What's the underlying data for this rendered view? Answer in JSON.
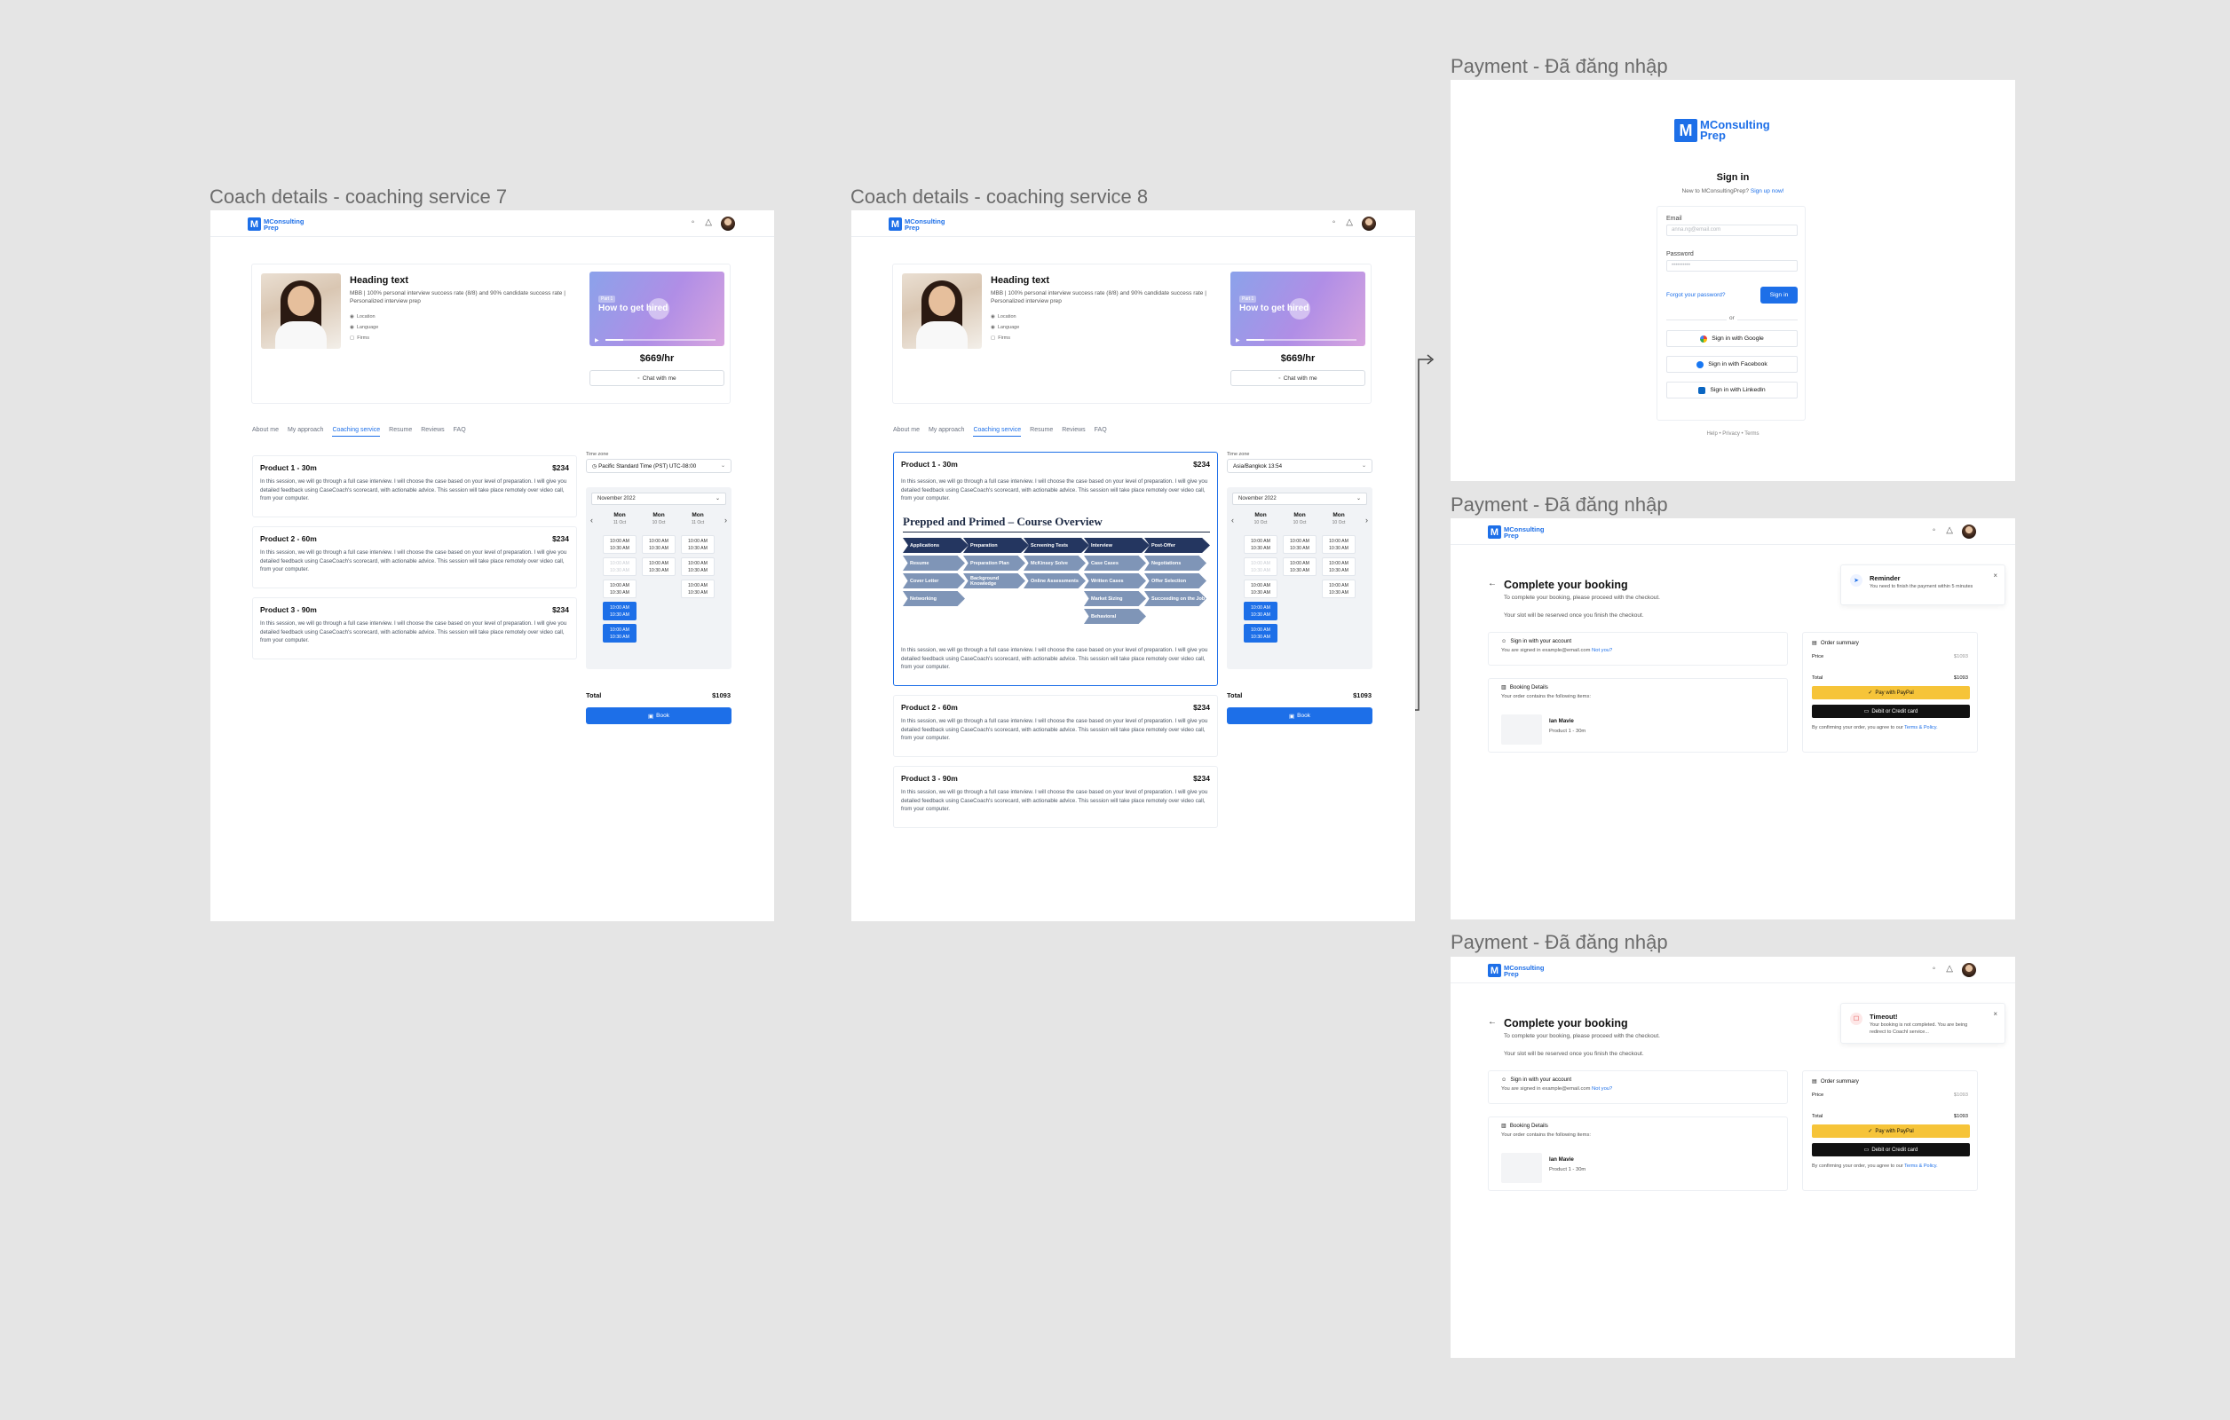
{
  "frames": {
    "coach7": {
      "label": "Coach details - coaching service 7"
    },
    "coach8": {
      "label": "Coach details - coaching service 8"
    },
    "pay1": {
      "label": "Payment - Đã đăng nhập"
    },
    "pay2": {
      "label": "Payment - Đã đăng nhập"
    },
    "pay3": {
      "label": "Payment - Đã đăng nhập"
    }
  },
  "brand": {
    "name": "MConsulting Prep",
    "logo_letter": "M",
    "accent": "#1d6fe8"
  },
  "header_icons": [
    "chat-icon",
    "bell-icon"
  ],
  "coach": {
    "heading": "Heading text",
    "description": "MBB | 100% personal interview success rate (8/8) and 90% candidate success rate | Personalized interview prep",
    "location": "Location",
    "language": "Language",
    "firms": "Firms",
    "video_tag": "Part 1",
    "video_title": "How to get hired",
    "price": "$669/hr",
    "chat_button": "Chat with me"
  },
  "tabs": [
    "About me",
    "My approach",
    "Coaching service",
    "Resume",
    "Reviews",
    "FAQ"
  ],
  "active_tab": "Coaching service",
  "products": [
    {
      "name": "Product 1 - 30m",
      "price": "$234",
      "description": "In this session, we will go through a full case interview. I will choose the case based on your level of preparation. I will give you detailed feedback using CaseCoach's scorecard, with actionable advice. This session will take place remotely over video call, from your computer."
    },
    {
      "name": "Product 2 - 60m",
      "price": "$234",
      "description": "In this session, we will go through a full case interview. I will choose the case based on your level of preparation. I will give you detailed feedback using CaseCoach's scorecard, with actionable advice. This session will take place remotely over video call, from your computer."
    },
    {
      "name": "Product 3 - 90m",
      "price": "$234",
      "description": "In this session, we will go through a full case interview. I will choose the case based on your level of preparation. I will give you detailed feedback using CaseCoach's scorecard, with actionable advice. This session will take place remotely over video call, from your computer."
    }
  ],
  "course_overview": {
    "title": "Prepped and Primed – Course Overview",
    "stages": [
      "Applications",
      "Preparation",
      "Screening Tests",
      "Interview",
      "Post-Offer"
    ],
    "items": [
      "Resume",
      "Preparation Plan",
      "McKinsey Solve",
      "Case Cases",
      "Negotiations",
      "Cover Letter",
      "Background Knowledge",
      "Online Assessments",
      "Written Cases",
      "Offer Selection",
      "Networking",
      "Market Sizing",
      "Succeeding on the Job",
      "Behavioral"
    ]
  },
  "booking_panel": {
    "timezone_label": "Time zone",
    "timezone_value_7": "Pacific Standard Time (PST) UTC-08:00",
    "timezone_value_8": "Asia/Bangkok 13:54",
    "month": "November 2022",
    "days_7": [
      {
        "name": "Mon",
        "date": "11 Oct"
      },
      {
        "name": "Mon",
        "date": "10 Oct"
      },
      {
        "name": "Mon",
        "date": "11 Oct"
      }
    ],
    "days_8": [
      {
        "name": "Mon",
        "date": "10 Oct"
      },
      {
        "name": "Mon",
        "date": "10 Oct"
      },
      {
        "name": "Mon",
        "date": "10 Oct"
      }
    ],
    "slot_line1": "10:00 AM",
    "slot_line2": "10:30 AM",
    "total_label": "Total",
    "total_value": "$1093",
    "book_button": "Book"
  },
  "signin": {
    "title": "Sign in",
    "new_prompt": "New to MConsultingPrep?",
    "signup_link": "Sign up now!",
    "email_label": "Email",
    "email_placeholder": "anna.ng@email.com",
    "password_label": "Password",
    "password_placeholder": "••••••••••",
    "forgot": "Forgot your password?",
    "signin_button": "Sign in",
    "or": "or",
    "google": "Sign in with Google",
    "facebook": "Sign in with Facebook",
    "linkedin": "Sign in with LinkedIn",
    "footer": [
      "Help",
      "Privacy",
      "Terms"
    ]
  },
  "checkout": {
    "title": "Complete your booking",
    "sub1": "To complete your booking, please proceed with the checkout.",
    "sub2": "Your slot will be reserved once you finish the checkout.",
    "account_title": "Sign in with your account",
    "account_text": "You are signed in example@email.com",
    "not_you": "Not you?",
    "details_title": "Booking Details",
    "details_text": "Your order contains the following items:",
    "coach_name": "Ian Mavie",
    "coach_product": "Product 1 - 30m",
    "summary_title": "Order summary",
    "price_label": "Price",
    "price_value": "$1093",
    "total_label": "Total",
    "total_value": "$1093",
    "paypal": "Pay with PayPal",
    "card": "Debit or Credit card",
    "agree": "By confirming your order, you agree to our",
    "terms": "Terms & Policy."
  },
  "toasts": {
    "reminder_title": "Reminder",
    "reminder_text": "You need to finish the payment within 5 minutes",
    "timeout_title": "Timeout!",
    "timeout_text": "Your booking is not completed. You are being redirect to CoachI service..."
  }
}
